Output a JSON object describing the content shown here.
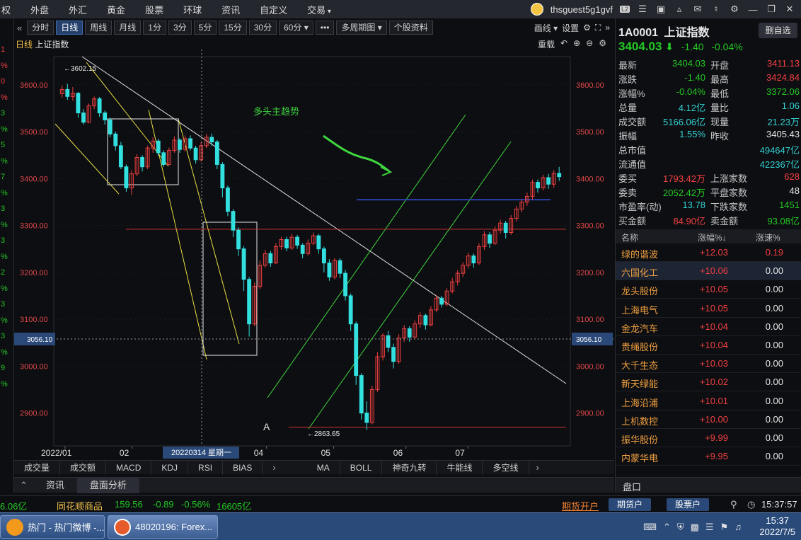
{
  "menu": {
    "items": [
      "权",
      "外盘",
      "外汇",
      "黄金",
      "股票",
      "环球",
      "资讯",
      "自定义",
      "交易"
    ],
    "user": "thsguest5g1gvf",
    "level": "L2"
  },
  "left_sliver": [
    {
      "text": "1",
      "color": "#f04040"
    },
    {
      "text": "%",
      "color": "#f04040"
    },
    {
      "text": "0",
      "color": "#f04040"
    },
    {
      "text": "%",
      "color": "#f04040"
    },
    {
      "text": "3",
      "color": "#23c823"
    },
    {
      "text": "%",
      "color": "#23c823"
    },
    {
      "text": "5",
      "color": "#23c823"
    },
    {
      "text": "%",
      "color": "#23c823"
    },
    {
      "text": "7",
      "color": "#23c823"
    },
    {
      "text": "%",
      "color": "#23c823"
    },
    {
      "text": "3",
      "color": "#23c823"
    },
    {
      "text": "%",
      "color": "#23c823"
    },
    {
      "text": "3",
      "color": "#23c823"
    },
    {
      "text": "%",
      "color": "#23c823"
    },
    {
      "text": "2",
      "color": "#23c823"
    },
    {
      "text": "%",
      "color": "#23c823"
    },
    {
      "text": "3",
      "color": "#23c823"
    },
    {
      "text": "%",
      "color": "#23c823"
    },
    {
      "text": "3",
      "color": "#23c823"
    },
    {
      "text": "%",
      "color": "#23c823"
    },
    {
      "text": "9",
      "color": "#23c823"
    },
    {
      "text": "%",
      "color": "#23c823"
    }
  ],
  "period_bar": {
    "collapse": "«",
    "buttons": [
      "分时",
      "日线",
      "周线",
      "月线",
      "1分",
      "3分",
      "5分",
      "15分",
      "30分",
      "60分 ▾",
      "•••",
      "多周期图 ▾",
      "个股资料"
    ],
    "active": "日线",
    "draw": "画线 ▾",
    "settings": "设置",
    "expand": "»"
  },
  "chart_header": {
    "period": "日线",
    "name": "上证指数",
    "reset": "重载"
  },
  "chart_annotations": {
    "trend_text": "多头主趋势",
    "letter": "A",
    "high_label": "3602.15",
    "low_label": "2863.65",
    "crosshair_price": "3056.10",
    "crosshair_date": "20220314 星期一"
  },
  "chart_data": {
    "type": "candlestick",
    "title": "上证指数 日线",
    "x_ticks": [
      "2022/01",
      "02",
      "03",
      "04",
      "05",
      "06",
      "07"
    ],
    "ylim": [
      2830,
      3660
    ],
    "y_ticks": [
      "3600.00",
      "3500.00",
      "3400.00",
      "3300.00",
      "3200.00",
      "3100.00",
      "3000.00",
      "2900.00"
    ],
    "y_tick_values": [
      3600,
      3500,
      3400,
      3300,
      3200,
      3100,
      3000,
      2900
    ],
    "high": 3602.15,
    "low": 2863.65,
    "reference_lines": [
      3355,
      3292,
      2870
    ],
    "candles": [
      [
        3581,
        3590,
        3572,
        3598
      ],
      [
        3590,
        3575,
        3568,
        3602
      ],
      [
        3575,
        3582,
        3566,
        3595
      ],
      [
        3582,
        3540,
        3530,
        3584
      ],
      [
        3540,
        3520,
        3515,
        3548
      ],
      [
        3520,
        3555,
        3518,
        3560
      ],
      [
        3555,
        3570,
        3548,
        3575
      ],
      [
        3570,
        3540,
        3532,
        3574
      ],
      [
        3540,
        3525,
        3515,
        3545
      ],
      [
        3525,
        3495,
        3488,
        3530
      ],
      [
        3495,
        3470,
        3460,
        3500
      ],
      [
        3470,
        3425,
        3420,
        3478
      ],
      [
        3425,
        3380,
        3372,
        3430
      ],
      [
        3380,
        3410,
        3365,
        3418
      ],
      [
        3410,
        3445,
        3405,
        3452
      ],
      [
        3445,
        3425,
        3415,
        3450
      ],
      [
        3425,
        3465,
        3420,
        3470
      ],
      [
        3465,
        3480,
        3455,
        3488
      ],
      [
        3480,
        3455,
        3448,
        3485
      ],
      [
        3455,
        3430,
        3425,
        3460
      ],
      [
        3430,
        3460,
        3428,
        3466
      ],
      [
        3460,
        3482,
        3455,
        3490
      ],
      [
        3482,
        3462,
        3455,
        3486
      ],
      [
        3462,
        3485,
        3458,
        3492
      ],
      [
        3485,
        3465,
        3460,
        3492
      ],
      [
        3465,
        3440,
        3432,
        3470
      ],
      [
        3440,
        3470,
        3436,
        3478
      ],
      [
        3470,
        3488,
        3465,
        3495
      ],
      [
        3488,
        3478,
        3470,
        3496
      ],
      [
        3478,
        3430,
        3420,
        3482
      ],
      [
        3430,
        3380,
        3360,
        3435
      ],
      [
        3380,
        3330,
        3320,
        3385
      ],
      [
        3330,
        3290,
        3275,
        3335
      ],
      [
        3290,
        3250,
        3235,
        3296
      ],
      [
        3250,
        3185,
        3160,
        3256
      ],
      [
        3185,
        3090,
        3063,
        3190
      ],
      [
        3090,
        3170,
        3085,
        3178
      ],
      [
        3170,
        3215,
        3165,
        3225
      ],
      [
        3215,
        3240,
        3210,
        3248
      ],
      [
        3240,
        3220,
        3212,
        3246
      ],
      [
        3220,
        3255,
        3218,
        3262
      ],
      [
        3255,
        3270,
        3248,
        3276
      ],
      [
        3270,
        3252,
        3245,
        3276
      ],
      [
        3252,
        3275,
        3248,
        3282
      ],
      [
        3275,
        3258,
        3250,
        3280
      ],
      [
        3258,
        3240,
        3230,
        3262
      ],
      [
        3240,
        3262,
        3236,
        3270
      ],
      [
        3262,
        3278,
        3258,
        3285
      ],
      [
        3278,
        3250,
        3240,
        3282
      ],
      [
        3250,
        3220,
        3200,
        3255
      ],
      [
        3220,
        3190,
        3182,
        3228
      ],
      [
        3190,
        3225,
        3185,
        3230
      ],
      [
        3225,
        3198,
        3188,
        3230
      ],
      [
        3198,
        3150,
        3140,
        3205
      ],
      [
        3150,
        3090,
        3075,
        3155
      ],
      [
        3090,
        2980,
        2960,
        3095
      ],
      [
        2980,
        2900,
        2886,
        2985
      ],
      [
        2900,
        2880,
        2864,
        2925
      ],
      [
        2880,
        2950,
        2876,
        2958
      ],
      [
        2950,
        3020,
        2945,
        3030
      ],
      [
        3020,
        3065,
        3012,
        3070
      ],
      [
        3065,
        3040,
        3030,
        3075
      ],
      [
        3040,
        3010,
        2995,
        3048
      ],
      [
        3010,
        3060,
        3005,
        3068
      ],
      [
        3060,
        3080,
        3052,
        3088
      ],
      [
        3080,
        3062,
        3052,
        3085
      ],
      [
        3062,
        3090,
        3058,
        3098
      ],
      [
        3090,
        3108,
        3082,
        3115
      ],
      [
        3108,
        3088,
        3078,
        3112
      ],
      [
        3088,
        3120,
        3085,
        3128
      ],
      [
        3120,
        3145,
        3115,
        3152
      ],
      [
        3145,
        3132,
        3125,
        3150
      ],
      [
        3132,
        3160,
        3128,
        3166
      ],
      [
        3160,
        3180,
        3155,
        3188
      ],
      [
        3180,
        3198,
        3172,
        3205
      ],
      [
        3198,
        3215,
        3190,
        3222
      ],
      [
        3215,
        3235,
        3208,
        3242
      ],
      [
        3235,
        3220,
        3210,
        3240
      ],
      [
        3220,
        3255,
        3216,
        3262
      ],
      [
        3255,
        3280,
        3248,
        3288
      ],
      [
        3280,
        3262,
        3252,
        3286
      ],
      [
        3262,
        3290,
        3258,
        3298
      ],
      [
        3290,
        3305,
        3282,
        3312
      ],
      [
        3305,
        3285,
        3272,
        3310
      ],
      [
        3285,
        3315,
        3280,
        3322
      ],
      [
        3315,
        3335,
        3308,
        3342
      ],
      [
        3335,
        3350,
        3328,
        3356
      ],
      [
        3350,
        3362,
        3342,
        3370
      ],
      [
        3362,
        3392,
        3355,
        3398
      ],
      [
        3392,
        3380,
        3370,
        3398
      ],
      [
        3380,
        3402,
        3375,
        3408
      ],
      [
        3402,
        3388,
        3378,
        3410
      ],
      [
        3388,
        3411,
        3380,
        3418
      ],
      [
        3411,
        3404,
        3395,
        3425
      ]
    ]
  },
  "indicator_tabs_left": [
    "成交量",
    "成交额",
    "MACD",
    "KDJ",
    "RSI",
    "BIAS"
  ],
  "indicator_tabs_right": [
    "MA",
    "BOLL",
    "神奇九转",
    "牛能线",
    "多空线"
  ],
  "info_tabs": [
    "资讯",
    "盘面分析"
  ],
  "panel": {
    "code": "1A0001",
    "name": "上证指数",
    "remove_label": "删自选",
    "price": "3404.03",
    "change": "-1.40",
    "change_pct": "-0.04%",
    "quotes": [
      {
        "l": "最新",
        "v": "3404.03",
        "vc": "green",
        "l2": "开盘",
        "v2": "3411.13",
        "v2c": "red"
      },
      {
        "l": "涨跌",
        "v": "-1.40",
        "vc": "green",
        "l2": "最高",
        "v2": "3424.84",
        "v2c": "red"
      },
      {
        "l": "涨幅%",
        "v": "-0.04%",
        "vc": "green",
        "l2": "最低",
        "v2": "3372.06",
        "v2c": "green"
      },
      {
        "l": "总量",
        "v": "4.12亿",
        "vc": "cyan",
        "l2": "量比",
        "v2": "1.06",
        "v2c": "cyan"
      },
      {
        "l": "成交额",
        "v": "5166.06亿",
        "vc": "cyan",
        "l2": "现量",
        "v2": "21.23万",
        "v2c": "cyan"
      },
      {
        "l": "振幅",
        "v": "1.55%",
        "vc": "cyan",
        "l2": "昨收",
        "v2": "3405.43",
        "v2c": "white"
      },
      {
        "l": "总市值",
        "v": "",
        "vc": "cyan",
        "l2": "",
        "v2": "494647亿",
        "v2c": "cyan"
      },
      {
        "l": "流通值",
        "v": "",
        "vc": "cyan",
        "l2": "",
        "v2": "422367亿",
        "v2c": "cyan"
      },
      {
        "l": "委买",
        "v": "1793.42万",
        "vc": "red",
        "l2": "上涨家数",
        "v2": "628",
        "v2c": "red"
      },
      {
        "l": "委卖",
        "v": "2052.42万",
        "vc": "green",
        "l2": "平盘家数",
        "v2": "48",
        "v2c": "white"
      },
      {
        "l": "市盈率(动)",
        "v": "13.78",
        "vc": "cyan",
        "l2": "下跌家数",
        "v2": "1451",
        "v2c": "green"
      },
      {
        "l": "买金额",
        "v": "84.90亿",
        "vc": "red",
        "l2": "卖金额",
        "v2": "93.08亿",
        "v2c": "green"
      }
    ],
    "rank_headers": [
      "名称",
      "涨幅%↓",
      "涨速%"
    ],
    "rank_rows": [
      {
        "name": "绿的谐波",
        "pct": "+12.03",
        "spd": "0.19",
        "spd_red": true
      },
      {
        "name": "六国化工",
        "pct": "+10.06",
        "spd": "0.00",
        "spd_red": false
      },
      {
        "name": "龙头股份",
        "pct": "+10.05",
        "spd": "0.00",
        "spd_red": false
      },
      {
        "name": "上海电气",
        "pct": "+10.05",
        "spd": "0.00",
        "spd_red": false
      },
      {
        "name": "金龙汽车",
        "pct": "+10.04",
        "spd": "0.00",
        "spd_red": false
      },
      {
        "name": "贵绳股份",
        "pct": "+10.04",
        "spd": "0.00",
        "spd_red": false
      },
      {
        "name": "大千生态",
        "pct": "+10.03",
        "spd": "0.00",
        "spd_red": false
      },
      {
        "name": "新天绿能",
        "pct": "+10.02",
        "spd": "0.00",
        "spd_red": false
      },
      {
        "name": "上海沿浦",
        "pct": "+10.01",
        "spd": "0.00",
        "spd_red": false
      },
      {
        "name": "上机数控",
        "pct": "+10.00",
        "spd": "0.00",
        "spd_red": false
      },
      {
        "name": "振华股份",
        "pct": "+9.99",
        "spd": "0.00",
        "spd_red": false
      },
      {
        "name": "内蒙华电",
        "pct": "+9.95",
        "spd": "0.00",
        "spd_red": false
      }
    ],
    "bottom_tab": "盘口"
  },
  "ticker": {
    "left_value": "6.06亿",
    "name": "同花顺商品",
    "price": "159.56",
    "change": "-0.89",
    "pct": "-0.56%",
    "amount": "16605亿",
    "futures_link": "期货开户",
    "btn1": "期货户",
    "btn2": "股票户",
    "time": "15:37:57"
  },
  "taskbar": {
    "app1": "热门 - 热门微博 -...",
    "app2": "48020196: Forex...",
    "time": "15:37",
    "date": "2022/7/5"
  },
  "colors": {
    "up": "#f04040",
    "down": "#23c823",
    "accent": "#25416b"
  }
}
